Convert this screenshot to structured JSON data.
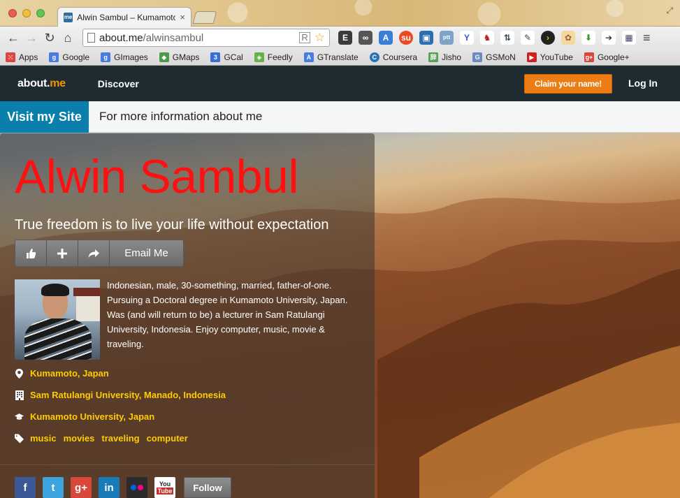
{
  "browser": {
    "tab_title": "Alwin Sambul – Kumamoto",
    "tab_favicon_text": "me",
    "url_host": "about.me",
    "url_path": "/alwinsambul",
    "bookmarks": [
      {
        "label": "Apps",
        "icon": "apps-grid-icon",
        "color": "#d44"
      },
      {
        "label": "Google",
        "icon": "google-icon",
        "color": "#4a7be0"
      },
      {
        "label": "GImages",
        "icon": "google-images-icon",
        "color": "#4a7be0"
      },
      {
        "label": "GMaps",
        "icon": "google-maps-icon",
        "color": "#4c9a4a"
      },
      {
        "label": "GCal",
        "icon": "google-calendar-icon",
        "color": "#3a6fd8"
      },
      {
        "label": "Feedly",
        "icon": "feedly-icon",
        "color": "#67b14b"
      },
      {
        "label": "GTranslate",
        "icon": "google-translate-icon",
        "color": "#4a7be0"
      },
      {
        "label": "Coursera",
        "icon": "coursera-icon",
        "color": "#2a73b8"
      },
      {
        "label": "Jisho",
        "icon": "jisho-icon",
        "color": "#5aa05a"
      },
      {
        "label": "GSMoN",
        "icon": "gsmon-icon",
        "color": "#6a8ac0"
      },
      {
        "label": "YouTube",
        "icon": "youtube-icon",
        "color": "#cc2222"
      },
      {
        "label": "Google+",
        "icon": "google-plus-icon",
        "color": "#d8473a"
      }
    ]
  },
  "site": {
    "brand_about": "about.",
    "brand_me": "me",
    "nav_discover": "Discover",
    "claim_button": "Claim your name!",
    "login": "Log In",
    "visit_button": "Visit my Site",
    "visit_text": "For more information about me"
  },
  "profile": {
    "name": "Alwin Sambul",
    "headline": "True freedom is to live your life without expectation",
    "email_button": "Email Me",
    "bio": "Indonesian, male, 30-something, married, father-of-one. Pursuing a Doctoral degree in Kumamoto University, Japan. Was (and will return to be) a lecturer in Sam Ratulangi University, Indonesia. Enjoy computer, music, movie & traveling.",
    "location": "Kumamoto, Japan",
    "work": "Sam Ratulangi University, Manado, Indonesia",
    "education": "Kumamoto University, Japan",
    "tags": [
      "music",
      "movies",
      "traveling",
      "computer"
    ],
    "follow_button": "Follow"
  },
  "colors": {
    "accent": "#f29800",
    "name_red": "#ff1010",
    "link_yellow": "#ffcc00",
    "visit_blue": "#0a7fab",
    "claim_orange": "#ec7d14"
  }
}
